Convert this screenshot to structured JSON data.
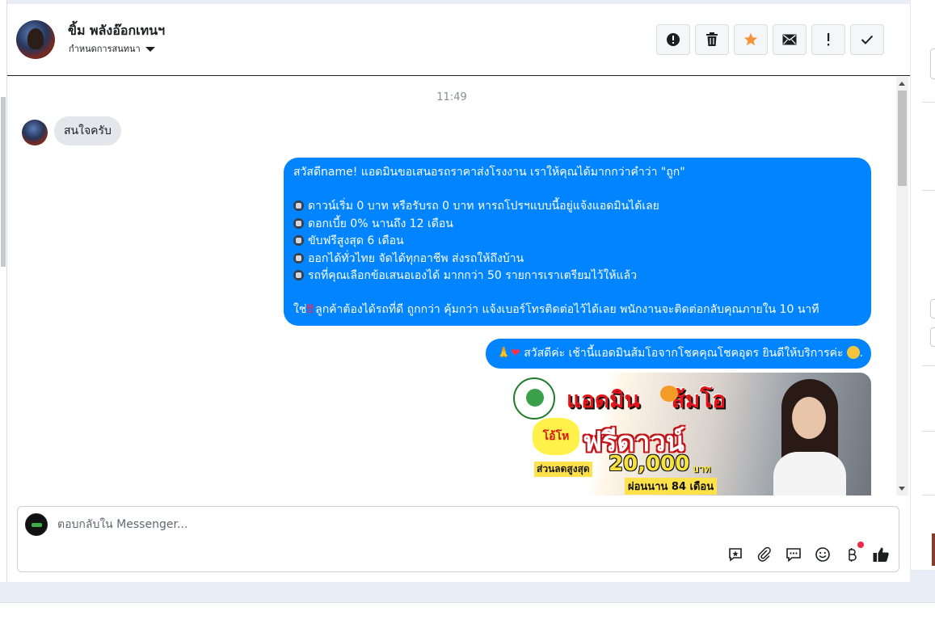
{
  "header": {
    "contact_name": "ขิ้ม พลังอ๊อกเทนฯ",
    "assign_label": "กำหนดการสนทนา",
    "actions": [
      {
        "name": "report-spam-button",
        "icon": "alert-circle-icon"
      },
      {
        "name": "delete-button",
        "icon": "trash-icon"
      },
      {
        "name": "star-button",
        "icon": "star-icon",
        "color": "#f7923a"
      },
      {
        "name": "mark-unread-button",
        "icon": "envelope-icon"
      },
      {
        "name": "follow-up-button",
        "icon": "exclamation-icon"
      },
      {
        "name": "mark-done-button",
        "icon": "checkmark-icon"
      }
    ]
  },
  "conversation": {
    "timestamp": "11:49",
    "incoming": {
      "text": "สนใจครับ"
    },
    "outgoing_1": {
      "intro": "สวัสดีname! แอดมินขอเสนอรถราคาส่งโรงงาน เราให้คุณได้มากกว่าคำว่า \"ถูก\"",
      "bullets": [
        "ดาวน์เริ่ม 0 บาท หรือรับรถ 0 บาท หารถโปรฯแบบนี้อยู่แจ้งแอดมินได้เลย",
        "ดอกเบี้ย 0% นานถึง 12 เดือน",
        "ขับฟรีสูงสุด 6 เดือน",
        "ออกได้ทั่วไทย จัดได้ทุกอาชีพ ส่งรถให้ถึงบ้าน",
        "รถที่คุณเลือกข้อเสนอเองได้ มากกว่า 50 รายการเราเตรียมไว้ให้แล้ว"
      ],
      "closing_prefix": "ใช่",
      "closing": "ลูกค้าต้องได้รถที่ดี ถูกกว่า คุ้มกว่า แจ้งเบอร์โทรติดต่อไว้ได้เลย พนักงานจะติดต่อกลับคุณภายใน 10 นาที"
    },
    "outgoing_2": {
      "text": "สวัสดีค่ะ เช้านี้แอดมินส้มโอจากโชคคุณโชคอุดร ยินดีให้บริการค่ะ",
      "trailing": "."
    },
    "promo_image": {
      "headline_left": "แอดมิน",
      "headline_right": "ส้มโอ",
      "burst": "โอ้โห",
      "subheadline": "ฟรีดาวน์",
      "discount_label": "ส่วนลดสูงสุด",
      "discount_amount": "20,000",
      "discount_unit": "บาท",
      "installment": "ผ่อนนาน 84 เดือน"
    }
  },
  "composer": {
    "placeholder": "ตอบกลับใน Messenger...",
    "value": "",
    "tools": [
      {
        "name": "saved-replies-icon"
      },
      {
        "name": "attach-icon"
      },
      {
        "name": "chat-bubble-icon"
      },
      {
        "name": "emoji-icon"
      },
      {
        "name": "baht-payment-icon"
      },
      {
        "name": "like-thumb-icon"
      }
    ]
  },
  "colors": {
    "accent": "#0084ff",
    "incoming_bubble": "#e4e6eb",
    "star": "#f7923a"
  }
}
